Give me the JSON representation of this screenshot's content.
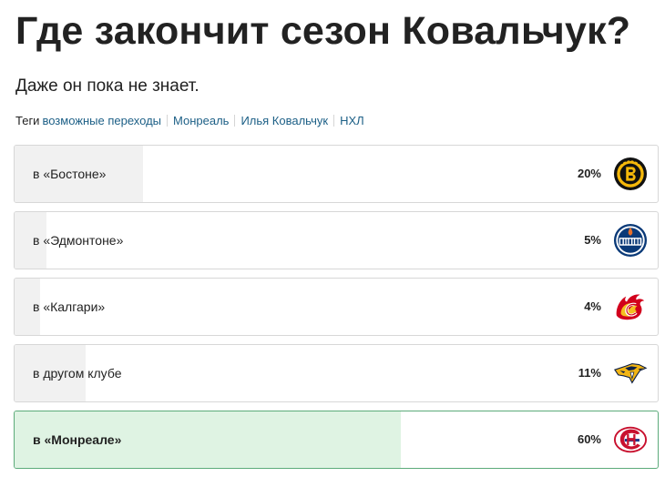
{
  "article": {
    "title": "Где закончит сезон Ковальчук?",
    "subtitle": "Даже он пока не знает."
  },
  "tags": {
    "label": "Теги",
    "items": [
      "возможные переходы",
      "Монреаль",
      "Илья Ковальчук",
      "НХЛ"
    ]
  },
  "poll": {
    "options": [
      {
        "label": "в «Бостоне»",
        "percent_text": "20%",
        "percent": 20,
        "logo": "boston-bruins-logo",
        "winner": false
      },
      {
        "label": "в «Эдмонтоне»",
        "percent_text": "5%",
        "percent": 5,
        "logo": "edmonton-oilers-logo",
        "winner": false
      },
      {
        "label": "в «Калгари»",
        "percent_text": "4%",
        "percent": 4,
        "logo": "calgary-flames-logo",
        "winner": false
      },
      {
        "label": "в другом клубе",
        "percent_text": "11%",
        "percent": 11,
        "logo": "nashville-predators-logo",
        "winner": false
      },
      {
        "label": "в «Монреале»",
        "percent_text": "60%",
        "percent": 60,
        "logo": "montreal-canadiens-logo",
        "winner": true
      }
    ]
  },
  "colors": {
    "bar_fill": "#f1f1f1",
    "winner_fill": "#dff3e3",
    "winner_border": "#5cab7a",
    "tag_link": "#1c5f86"
  }
}
